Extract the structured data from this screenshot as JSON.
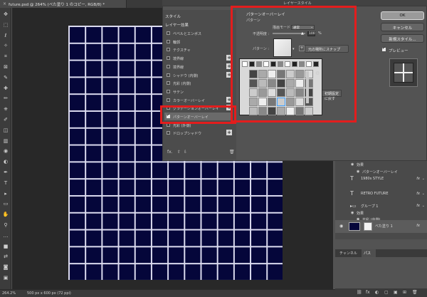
{
  "document": {
    "tab_title": "future.psd @ 264% (べた塗り 1 のコピー, RGB/8) *",
    "close_glyph": "×"
  },
  "status_bar": {
    "zoom": "264.2%",
    "doc_size": "500 px x 600 px (72 ppi)"
  },
  "tools": [
    "move-tool-icon",
    "marquee-tool-icon",
    "lasso-tool-icon",
    "magic-wand-icon",
    "crop-tool-icon",
    "frame-tool-icon",
    "eyedropper-icon",
    "healing-brush-icon",
    "brush-tool-icon",
    "stamp-tool-icon",
    "history-brush-icon",
    "eraser-icon",
    "gradient-icon",
    "blur-icon",
    "dodge-icon",
    "pen-tool-icon",
    "type-tool-icon",
    "path-select-icon",
    "rectangle-icon",
    "hand-tool-icon",
    "zoom-tool-icon",
    "more-icon",
    "color-swatch-icon",
    "swap-icon",
    "quick-mask-icon",
    "screen-mode-icon"
  ],
  "tool_glyphs": [
    "✥",
    "⬚",
    "ℓ",
    "✧",
    "⌗",
    "⊠",
    "✎",
    "✚",
    "✏",
    "⎈",
    "✐",
    "◫",
    "▥",
    "◉",
    "◐",
    "✒",
    "T",
    "▸",
    "▭",
    "✋",
    "⚲",
    "…",
    "■",
    "⇄",
    "◙",
    "▣"
  ],
  "dialog": {
    "title": "レイヤースタイル",
    "styles_header": "スタイル",
    "effects_header": "レイヤー効果",
    "items": [
      {
        "label": "ベベルとエンボス",
        "checked": false,
        "plus": false
      },
      {
        "label": "輪郭",
        "checked": false,
        "plus": false
      },
      {
        "label": "テクスチャ",
        "checked": false,
        "plus": false
      },
      {
        "label": "境界線",
        "checked": false,
        "plus": true
      },
      {
        "label": "境界線",
        "checked": false,
        "plus": true
      },
      {
        "label": "シャドウ (内側)",
        "checked": false,
        "plus": true
      },
      {
        "label": "光彩 (内側)",
        "checked": false,
        "plus": false
      },
      {
        "label": "サテン",
        "checked": false,
        "plus": false
      },
      {
        "label": "カラーオーバーレイ",
        "checked": false,
        "plus": true
      },
      {
        "label": "グラデーションオーバーレイ",
        "checked": false,
        "plus": true
      },
      {
        "label": "パターンオーバーレイ",
        "checked": true,
        "plus": false
      },
      {
        "label": "光彩 (外側)",
        "checked": false,
        "plus": false
      },
      {
        "label": "ドロップシャドウ",
        "checked": false,
        "plus": true
      }
    ],
    "footer": {
      "fx": "fx.",
      "up": "⇧",
      "down": "⇩",
      "trash": "🗑"
    },
    "pattern_section": {
      "heading": "パターンオーバーレイ",
      "subheading": "パターン",
      "blend_label": "描画モード :",
      "blend_value": "通常",
      "opacity_label": "不透明度 :",
      "opacity_value": "100",
      "opacity_unit": "%",
      "pattern_label": "パターン :",
      "snap_button": "元の場所にスナップ",
      "reset_button": "初期設定に戻す"
    },
    "buttons": {
      "ok": "OK",
      "cancel": "キャンセル",
      "new_style": "新規スタイル...",
      "preview": "プレビュー"
    }
  },
  "layers": {
    "rows": [
      {
        "label": "効果",
        "type": "effect",
        "indent": 30
      },
      {
        "label": "パターンオーバーレイ",
        "type": "effect",
        "indent": 38
      },
      {
        "label": "1980s STYLE",
        "type": "text",
        "fx": "fx"
      },
      {
        "label": "RETRO FUTURE",
        "type": "text",
        "fx": "fx"
      },
      {
        "label": "グループ 1",
        "type": "group",
        "fx": "fx"
      },
      {
        "label": "効果",
        "type": "effect",
        "indent": 30
      },
      {
        "label": "光彩 (内側)",
        "type": "effect",
        "indent": 38
      }
    ],
    "fill_layer": {
      "label": "べた塗り 1",
      "fx": "fx"
    },
    "channel_tabs": [
      "チャンネル",
      "パス"
    ],
    "bottom_icons": [
      "⛓",
      "fx",
      "◐",
      "▢",
      "▣",
      "⊞",
      "🗑"
    ]
  },
  "colors": {
    "accent_red": "#e31d1d",
    "artwork_bg": "#05063a",
    "grid_line": "#dcdcf0"
  }
}
